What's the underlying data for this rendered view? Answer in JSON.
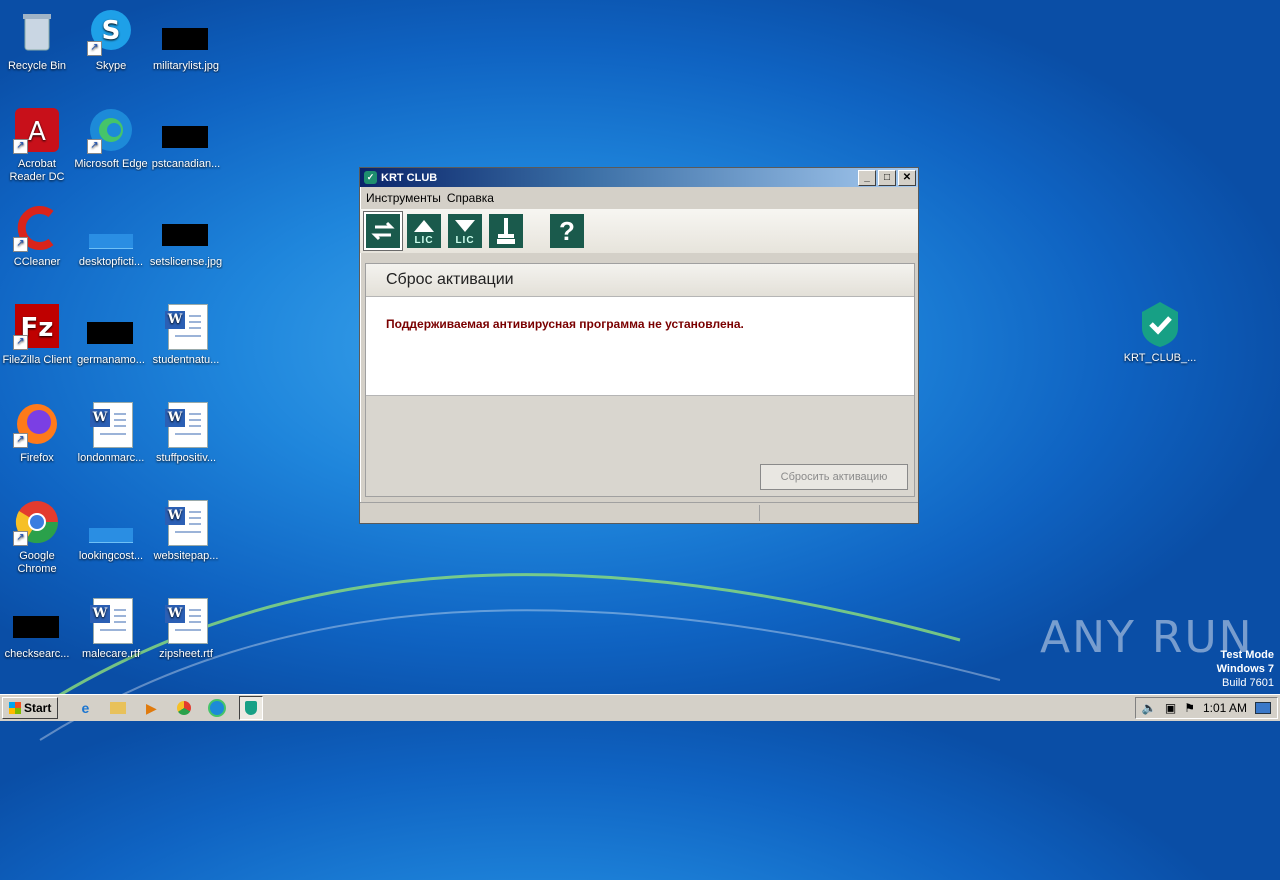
{
  "desktop_icons": [
    {
      "label": "Recycle Bin"
    },
    {
      "label": "Skype"
    },
    {
      "label": "militarylist.jpg"
    },
    {
      "label": "Acrobat Reader DC"
    },
    {
      "label": "Microsoft Edge"
    },
    {
      "label": "pstcanadian..."
    },
    {
      "label": "CCleaner"
    },
    {
      "label": "desktopficti..."
    },
    {
      "label": "setslicense.jpg"
    },
    {
      "label": "FileZilla Client"
    },
    {
      "label": "germanamo..."
    },
    {
      "label": "studentnatu..."
    },
    {
      "label": "Firefox"
    },
    {
      "label": "londonmarc..."
    },
    {
      "label": "stuffpositiv..."
    },
    {
      "label": "Google Chrome"
    },
    {
      "label": "lookingcost..."
    },
    {
      "label": "websitepap..."
    },
    {
      "label": "checksearc..."
    },
    {
      "label": "malecare.rtf"
    },
    {
      "label": "zipsheet.rtf"
    },
    {
      "label": "KRT_CLUB_..."
    }
  ],
  "window": {
    "title": "KRT CLUB",
    "menu": [
      "Инструменты",
      "Справка"
    ],
    "toolbar": {
      "lic_label": "LIC",
      "help_glyph": "?"
    },
    "panel_title": "Сброс активации",
    "message": "Поддерживаемая антивирусная программа не установлена.",
    "reset_button": "Сбросить активацию"
  },
  "watermark": "ANY RUN",
  "testmode": {
    "line1": "Test Mode",
    "line2": "Windows 7",
    "line3": "Build 7601"
  },
  "taskbar": {
    "start": "Start",
    "clock": "1:01 AM"
  },
  "colors": {
    "accent_green": "#1a5a4c",
    "error_text": "#7a0000"
  }
}
